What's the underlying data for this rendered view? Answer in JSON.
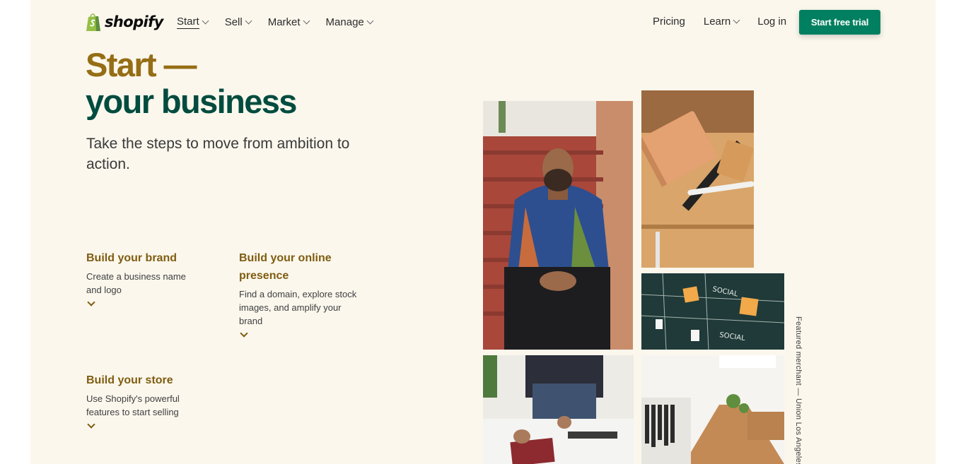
{
  "header": {
    "logo_text": "shopify",
    "nav_left": [
      {
        "label": "Start"
      },
      {
        "label": "Sell"
      },
      {
        "label": "Market"
      },
      {
        "label": "Manage"
      }
    ],
    "nav_right": {
      "pricing": "Pricing",
      "learn": "Learn",
      "login": "Log in"
    },
    "cta": "Start free trial"
  },
  "hero": {
    "title_line1": "Start —",
    "title_line2": "your business",
    "subtitle": "Take the steps to move from ambition to action."
  },
  "features": [
    {
      "title": "Build your brand",
      "desc": "Create a business name and logo"
    },
    {
      "title": "Build your online presence",
      "desc": "Find a domain, explore stock images, and amplify your brand"
    },
    {
      "title": "Build your store",
      "desc": "Use Shopify's powerful features to start selling"
    }
  ],
  "caption": "Featured merchant — Union Los Angeles",
  "colors": {
    "background": "#fbf7ed",
    "brand_green": "#008060",
    "title_gold": "#956d14",
    "title_dark_green": "#004c3f",
    "feature_gold": "#7f5d11"
  }
}
